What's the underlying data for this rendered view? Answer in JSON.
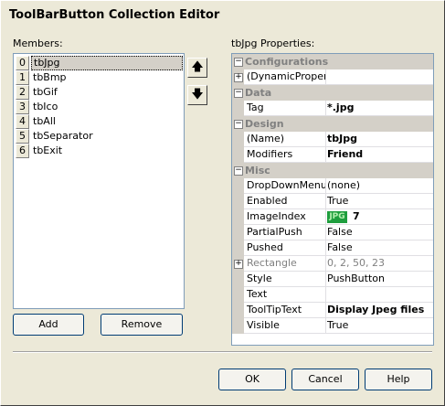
{
  "window": {
    "title": "ToolBarButton Collection Editor"
  },
  "members": {
    "label": "Members:",
    "items": [
      {
        "index": "0",
        "name": "tbJpg"
      },
      {
        "index": "1",
        "name": "tbBmp"
      },
      {
        "index": "2",
        "name": "tbGif"
      },
      {
        "index": "3",
        "name": "tbIco"
      },
      {
        "index": "4",
        "name": "tbAll"
      },
      {
        "index": "5",
        "name": "tbSeparator"
      },
      {
        "index": "6",
        "name": "tbExit"
      }
    ],
    "selected_index": 0,
    "move_up_icon": "up-arrow-icon",
    "move_down_icon": "down-arrow-icon",
    "add_label": "Add",
    "remove_label": "Remove"
  },
  "properties": {
    "label": "tbJpg Properties:",
    "categories": [
      {
        "name": "Configurations",
        "rows": [
          {
            "name": "(DynamicPropertie",
            "value": "",
            "expandable": true
          }
        ]
      },
      {
        "name": "Data",
        "rows": [
          {
            "name": "Tag",
            "value": "*.jpg",
            "bold": true
          }
        ]
      },
      {
        "name": "Design",
        "rows": [
          {
            "name": "(Name)",
            "value": "tbJpg",
            "bold": true
          },
          {
            "name": "Modifiers",
            "value": "Friend",
            "bold": true
          }
        ]
      },
      {
        "name": "Misc",
        "rows": [
          {
            "name": "DropDownMenu",
            "value": "(none)"
          },
          {
            "name": "Enabled",
            "value": "True"
          },
          {
            "name": "ImageIndex",
            "value": "7",
            "bold": true,
            "icon_text": "JPG"
          },
          {
            "name": "PartialPush",
            "value": "False"
          },
          {
            "name": "Pushed",
            "value": "False"
          },
          {
            "name": "Rectangle",
            "value": "0, 2, 50, 23",
            "disabled": true,
            "expandable": true
          },
          {
            "name": "Style",
            "value": "PushButton"
          },
          {
            "name": "Text",
            "value": ""
          },
          {
            "name": "ToolTipText",
            "value": "Display Jpeg files",
            "bold": true
          },
          {
            "name": "Visible",
            "value": "True"
          }
        ]
      }
    ]
  },
  "footer": {
    "ok_label": "OK",
    "cancel_label": "Cancel",
    "help_label": "Help"
  }
}
